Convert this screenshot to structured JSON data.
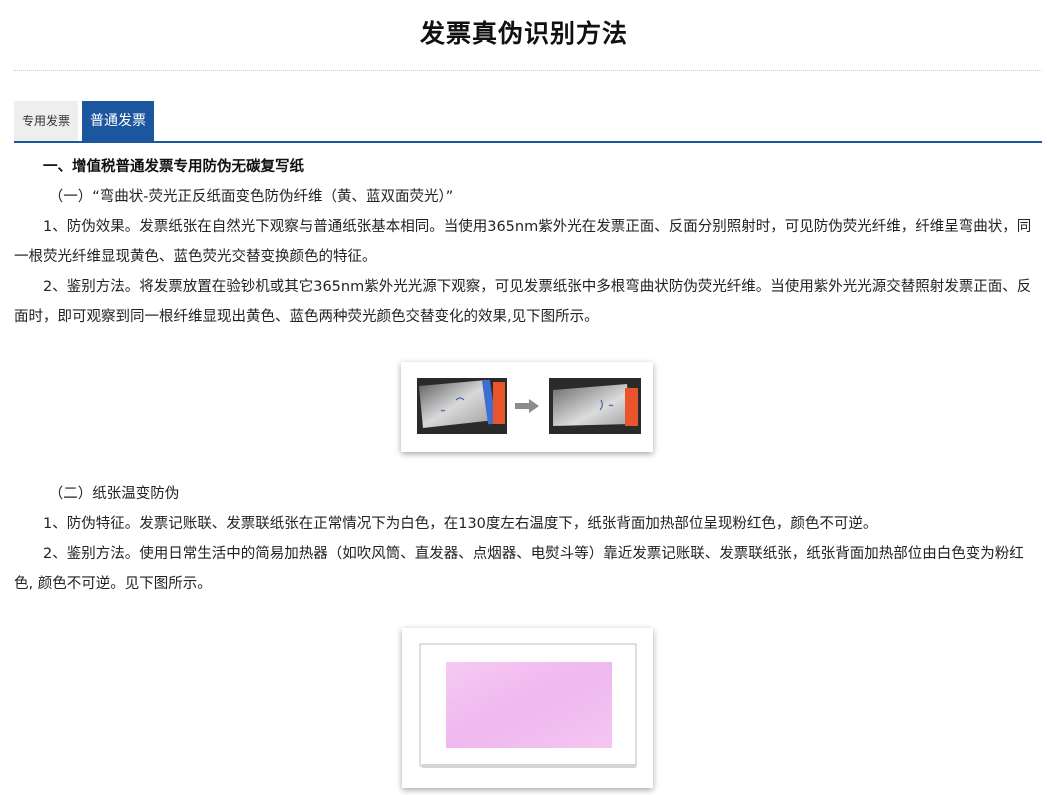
{
  "page": {
    "title": "发票真伪识别方法"
  },
  "tabs": [
    {
      "label": "专用发票",
      "active": false
    },
    {
      "label": "普通发票",
      "active": true
    }
  ],
  "section1": {
    "heading": "一、增值税普通发票专用防伪无碳复写纸",
    "sub_heading": "（一）“弯曲状-荧光正反纸面变色防伪纤维（黄、蓝双面荧光）”",
    "para1": "1、防伪效果。发票纸张在自然光下观察与普通纸张基本相同。当使用365nm紫外光在发票正面、反面分别照射时，可见防伪荧光纤维，纤维呈弯曲状，同一根荧光纤维显现黄色、蓝色荧光交替变换颜色的特征。",
    "para2": "2、鉴别方法。将发票放置在验钞机或其它365nm紫外光光源下观察，可见发票纸张中多根弯曲状防伪荧光纤维。当使用紫外光光源交替照射发票正面、反面时，即可观察到同一根纤维显现出黄色、蓝色两种荧光颜色交替变化的效果,见下图所示。"
  },
  "section2": {
    "sub_heading": "（二）纸张温变防伪",
    "para1": "1、防伪特征。发票记账联、发票联纸张在正常情况下为白色，在130度左右温度下，纸张背面加热部位呈现粉红色，颜色不可逆。",
    "para2": "2、鉴别方法。使用日常生活中的简易加热器（如吹风筒、直发器、点烟器、电熨斗等）靠近发票记账联、发票联纸张，纸张背面加热部位由白色变为粉红色, 颜色不可逆。见下图所示。"
  },
  "colors": {
    "accent": "#1c569f",
    "pink": "#f3c2f0"
  }
}
